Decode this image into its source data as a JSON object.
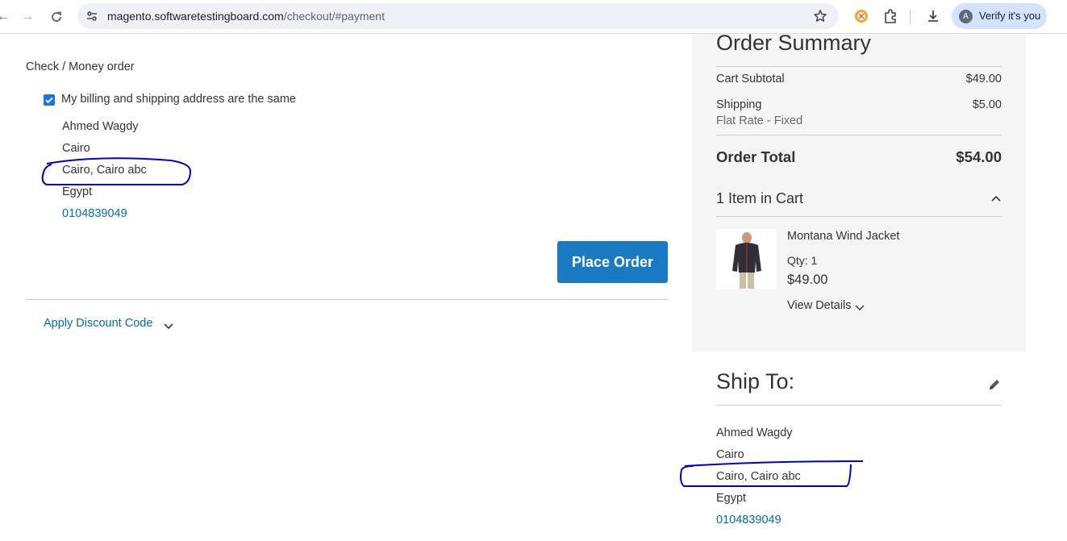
{
  "browser": {
    "url_host": "magento.softwaretestingboard.com",
    "url_path": "/checkout/#payment",
    "profile_label": "Verify it's you",
    "profile_initial": "A"
  },
  "payment": {
    "method_title": "Check / Money order",
    "same_address_label": "My billing and shipping address are the same",
    "same_address_checked": true,
    "address": {
      "name": "Ahmed Wagdy",
      "street": "Cairo",
      "city_region": "Cairo, Cairo abc",
      "country": "Egypt",
      "phone": "0104839049"
    },
    "place_order_label": "Place Order",
    "discount_label": "Apply Discount Code"
  },
  "summary": {
    "title": "Order Summary",
    "cart_subtotal_label": "Cart Subtotal",
    "cart_subtotal_value": "$49.00",
    "shipping_label": "Shipping",
    "shipping_method": "Flat Rate - Fixed",
    "shipping_value": "$5.00",
    "order_total_label": "Order Total",
    "order_total_value": "$54.00",
    "items_in_cart_label": "1 Item in Cart",
    "item": {
      "name": "Montana Wind Jacket",
      "qty_label": "Qty: 1",
      "price": "$49.00",
      "view_details_label": "View Details"
    }
  },
  "ship_to": {
    "title": "Ship To:",
    "name": "Ahmed Wagdy",
    "street": "Cairo",
    "city_region": "Cairo, Cairo abc",
    "country": "Egypt",
    "phone": "0104839049"
  },
  "colors": {
    "accent": "#1979c3",
    "link": "#006bb4",
    "sidebar_bg": "#f5f5f5",
    "annotation": "#0000cc"
  }
}
